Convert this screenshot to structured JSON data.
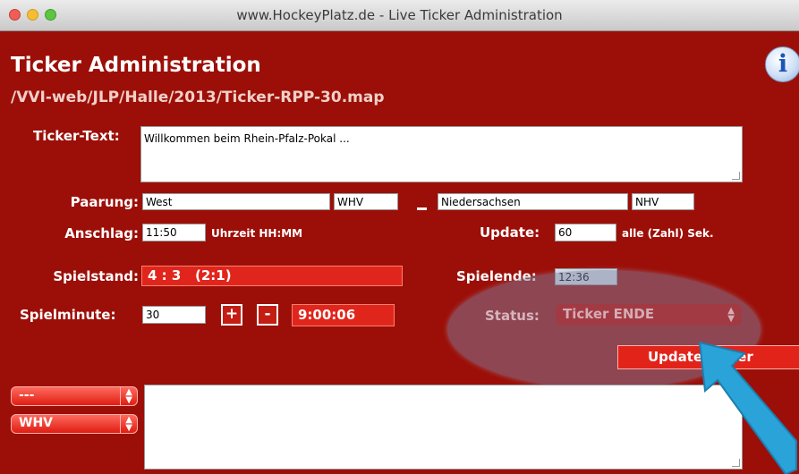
{
  "window": {
    "title": "www.HockeyPlatz.de - Live Ticker Administration"
  },
  "header": {
    "title": "Ticker Administration",
    "path": "/VVI-web/JLP/Halle/2013/Ticker-RPP-30.map",
    "info_glyph": "i"
  },
  "ticker_text": {
    "label": "Ticker-Text:",
    "value": "Willkommen beim Rhein-Pfalz-Pokal ..."
  },
  "pairing": {
    "label": "Paarung:",
    "team1": "West",
    "team1_short": "WHV",
    "separator": "-",
    "team2": "Niedersachsen",
    "team2_short": "NHV"
  },
  "kickoff": {
    "label": "Anschlag:",
    "value": "11:50",
    "hint": "Uhrzeit HH:MM"
  },
  "update_interval": {
    "label": "Update:",
    "value": "60",
    "hint": "alle (Zahl) Sek."
  },
  "score": {
    "label": "Spielstand:",
    "value": "4 : 3   (2:1)"
  },
  "game_end": {
    "label": "Spielende:",
    "value": "12:36"
  },
  "minute": {
    "label": "Spielminute:",
    "value": "30",
    "plus": "+",
    "minus": "-",
    "clock": "9:00:06"
  },
  "status": {
    "label": "Status:",
    "value": "Ticker ENDE"
  },
  "update_button": {
    "label": "Update Ticker"
  },
  "event_selects": {
    "event_type": "---",
    "team": "WHV"
  },
  "icons": {
    "info": "info-icon",
    "arrow": "pointer-arrow-icon"
  },
  "colors": {
    "background": "#9c0f08",
    "accent_red": "#e0261c",
    "arrow": "#29a3d8",
    "overlay": "#7d7d9b"
  }
}
